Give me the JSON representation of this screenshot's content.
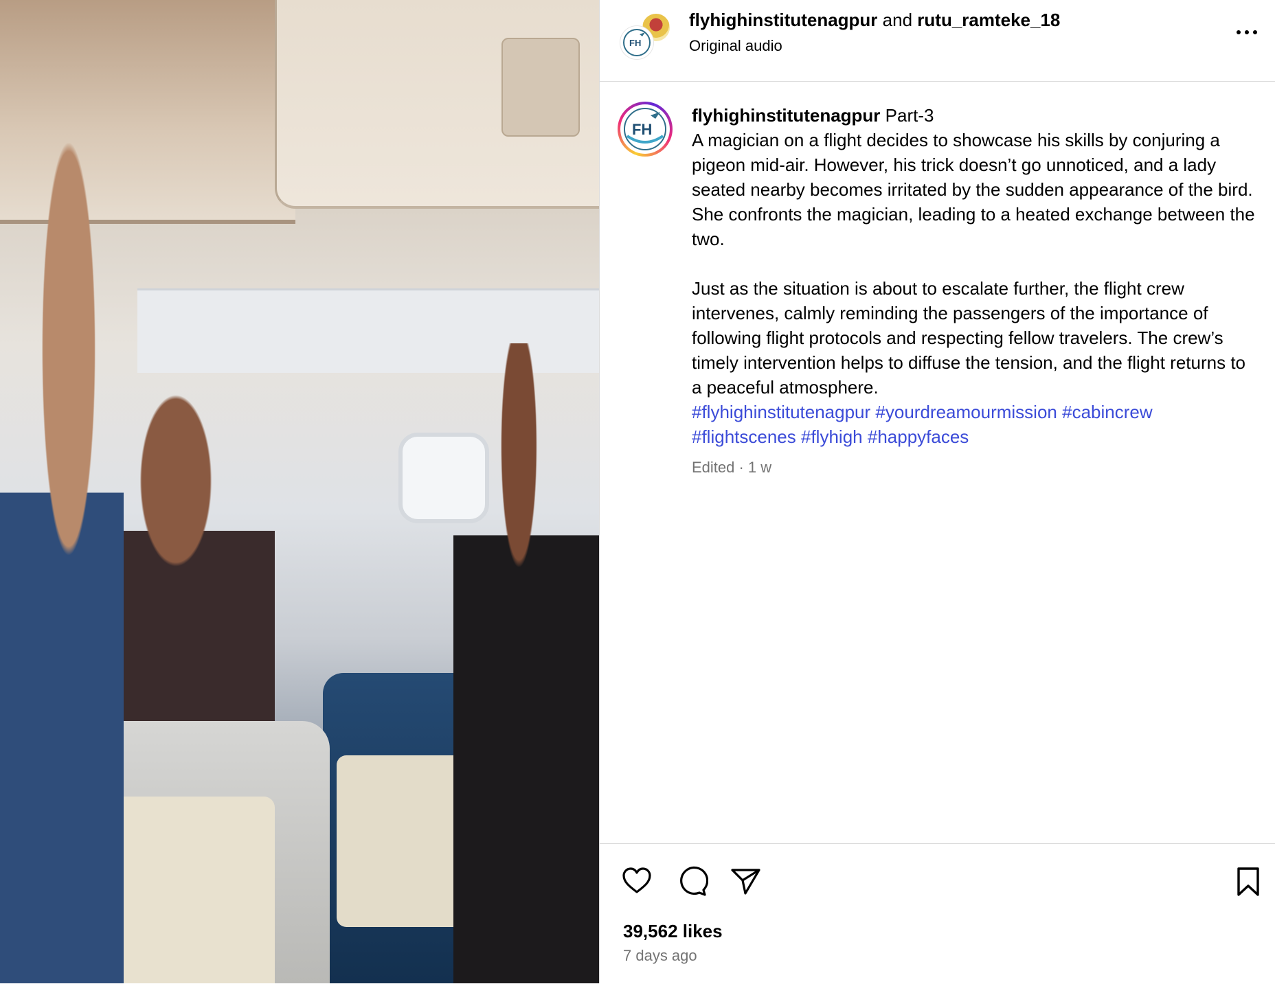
{
  "post": {
    "media": {
      "alt": "Video still inside an airplane cabin"
    },
    "header": {
      "author1": "flyhighinstitutenagpur",
      "and_text": "and",
      "author2": "rutu_ramteke_18",
      "audio": "Original audio",
      "more_icon": "more-horizontal-icon",
      "logo_text": "FH"
    },
    "caption": {
      "username": "flyhighinstitutenagpur",
      "title": "Part-3",
      "paragraph1": "A magician on a flight decides to showcase his skills by conjuring a pigeon mid-air. However, his trick doesn’t go unnoticed, and a lady seated nearby becomes irritated by the sudden appearance of the bird. She confronts the magician, leading to a heated exchange between the two.",
      "paragraph2": "Just as the situation is about to escalate further, the flight crew intervenes, calmly reminding the passengers of the importance of following flight protocols and respecting fellow travelers. The crew’s timely intervention helps to diffuse the tension, and the flight returns to a peaceful atmosphere.",
      "hashtags": [
        "#flyhighinstitutenagpur",
        "#yourdreamourmission",
        "#cabincrew",
        "#flightscenes",
        "#flyhigh",
        "#happyfaces"
      ],
      "edited": "Edited · 1 w"
    },
    "actions": {
      "like_icon": "heart-icon",
      "comment_icon": "comment-icon",
      "share_icon": "send-icon",
      "save_icon": "bookmark-icon"
    },
    "likes": "39,562 likes",
    "time_ago": "7 days ago"
  },
  "colors": {
    "hashtag": "#3b4bd8",
    "muted": "#737373",
    "divider": "#dbdbdb"
  }
}
